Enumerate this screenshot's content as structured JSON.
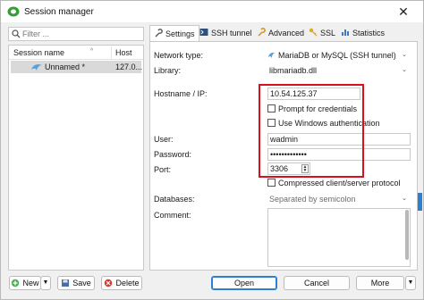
{
  "window": {
    "title": "Session manager"
  },
  "filter": {
    "placeholder": "Filter ..."
  },
  "list": {
    "col_name": "Session name",
    "col_host": "Host",
    "rows": [
      {
        "name": "Unnamed *",
        "host": "127.0..."
      }
    ]
  },
  "tabs": [
    {
      "label": "Settings",
      "icon": "wrench-icon",
      "active": true
    },
    {
      "label": "SSH tunnel",
      "icon": "terminal-icon"
    },
    {
      "label": "Advanced",
      "icon": "wrench-icon"
    },
    {
      "label": "SSL",
      "icon": "key-icon"
    },
    {
      "label": "Statistics",
      "icon": "chart-icon"
    }
  ],
  "settings": {
    "network_type_label": "Network type:",
    "network_type_value": "MariaDB or MySQL (SSH tunnel)",
    "library_label": "Library:",
    "library_value": "libmariadb.dll",
    "hostname_label": "Hostname / IP:",
    "hostname_value": "10.54.125.37",
    "prompt_credentials": "Prompt for credentials",
    "windows_auth": "Use Windows authentication",
    "user_label": "User:",
    "user_value": "wadmin",
    "password_label": "Password:",
    "password_value": "•••••••••••••",
    "port_label": "Port:",
    "port_value": "3306",
    "compressed": "Compressed client/server protocol",
    "databases_label": "Databases:",
    "databases_placeholder": "Separated by semicolon",
    "comment_label": "Comment:"
  },
  "buttons": {
    "new": "New",
    "save": "Save",
    "delete": "Delete",
    "open": "Open",
    "cancel": "Cancel",
    "more": "More"
  },
  "colors": {
    "highlight_box": "#d6111e",
    "accent": "#2e7fd1"
  }
}
